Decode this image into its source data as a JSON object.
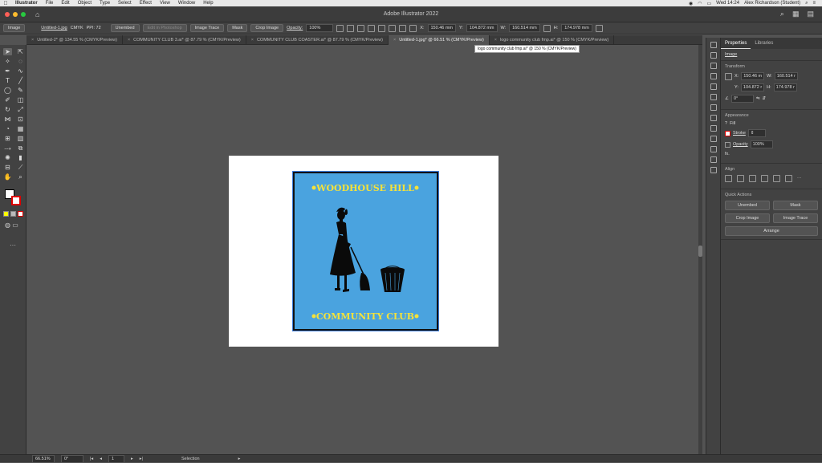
{
  "menubar": {
    "app": "Illustrator",
    "items": [
      "File",
      "Edit",
      "Object",
      "Type",
      "Select",
      "Effect",
      "View",
      "Window",
      "Help"
    ],
    "clock": "Wed 14:24",
    "user": "Alex Richardson (Student)"
  },
  "window": {
    "title": "Adobe Illustrator 2022"
  },
  "control": {
    "type": "Image",
    "filename": "Untitled-1.jpg",
    "colormode": "CMYK",
    "ppi": "PPI: 72",
    "unembed": "Unembed",
    "edit_photoshop": "Edit in Photoshop",
    "image_trace": "Image Trace",
    "mask": "Mask",
    "crop": "Crop Image",
    "opacity_label": "Opacity:",
    "opacity_value": "100%",
    "x_label": "X:",
    "x_value": "150.46 mm",
    "y_label": "Y:",
    "y_value": "104.872 mm",
    "w_label": "W:",
    "w_value": "160.514 mm",
    "h_label": "H:",
    "h_value": "174.978 mm"
  },
  "tabs": [
    {
      "label": "Untitled-2* @ 134.55 % (CMYK/Preview)"
    },
    {
      "label": "COMMUNITY CLUB 3.ai* @ 87.79 % (CMYK/Preview)"
    },
    {
      "label": "COMMUNITY CLUB COASTER.ai* @ 87.79 % (CMYK/Preview)"
    },
    {
      "label": "Untitled-1.jpg* @ 66.51 % (CMYK/Preview)"
    },
    {
      "label": "logo community club fmp.ai* @ 150 % (CMYK/Preview)"
    }
  ],
  "tooltip": "logo community club fmp.ai* @ 150 % (CMYK/Preview)",
  "artwork": {
    "top_text": "WOODHOUSE HILL",
    "bottom_text": "COMMUNITY CLUB",
    "bg_color": "#4aa3df",
    "text_color": "#f5e23a"
  },
  "panel": {
    "tab_properties": "Properties",
    "tab_libraries": "Libraries",
    "object_type": "Image",
    "transform": "Transform",
    "x_label": "X:",
    "x_value": "150.46 m",
    "y_label": "Y:",
    "y_value": "104.872 r",
    "w_label": "W:",
    "w_value": "160.514 r",
    "h_label": "H:",
    "h_value": "174.978 r",
    "angle": "0°",
    "appearance": "Appearance",
    "fill": "Fill",
    "stroke": "Stroke",
    "opacity": "Opacity",
    "opacity_value": "100%",
    "fx": "fx.",
    "align": "Align",
    "quick_actions": "Quick Actions",
    "qa_unembed": "Unembed",
    "qa_mask": "Mask",
    "qa_crop": "Crop Image",
    "qa_trace": "Image Trace",
    "qa_arrange": "Arrange"
  },
  "status": {
    "zoom": "66.51%",
    "rotation": "0°",
    "artboard": "1",
    "tool": "Selection"
  }
}
